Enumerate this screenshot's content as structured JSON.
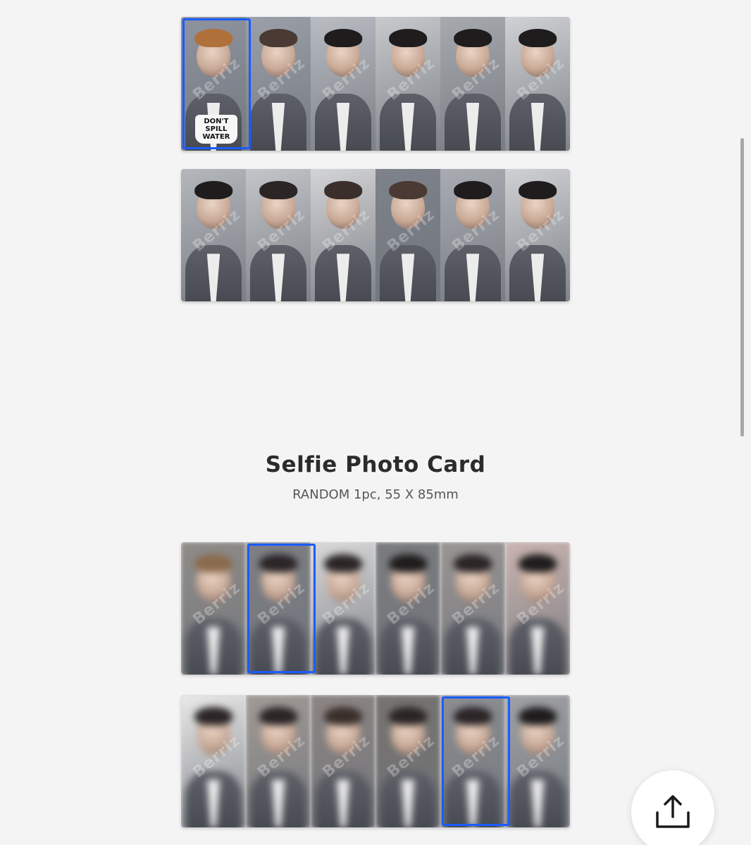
{
  "section": {
    "title": "Selfie Photo Card",
    "subtitle": "RANDOM 1pc, 55 X 85mm"
  },
  "watermark_text": "Berriz",
  "share_button": {
    "icon": "share-upload-icon"
  },
  "colors": {
    "background": "#f4f4f4",
    "highlight": "#1a5cff",
    "title_text": "#2b2b2b",
    "subtitle_text": "#555555"
  },
  "strips": [
    {
      "name": "photo-card-strip-1",
      "blurred": false,
      "highlight_index": 0,
      "cards": [
        {
          "bg": "#8e939e",
          "hair": "#b0703a",
          "mug_text": "DON'T SPILL WATER"
        },
        {
          "bg": "#9ba0a8",
          "hair": "#4a3a33"
        },
        {
          "bg": "#b9bcc2",
          "hair": "#1f1c1d"
        },
        {
          "bg": "#c7c9cc",
          "hair": "#1f1c1d"
        },
        {
          "bg": "#a6a9ae",
          "hair": "#1f1c1d"
        },
        {
          "bg": "#cfd1d4",
          "hair": "#1f1c1d"
        }
      ]
    },
    {
      "name": "photo-card-strip-2",
      "blurred": false,
      "highlight_index": -1,
      "cards": [
        {
          "bg": "#b4b7bc",
          "hair": "#1f1c1d"
        },
        {
          "bg": "#c3c5c9",
          "hair": "#2b2526"
        },
        {
          "bg": "#d3d4d6",
          "hair": "#3a2f2a"
        },
        {
          "bg": "#7e828a",
          "hair": "#4a3a33"
        },
        {
          "bg": "#a9acb2",
          "hair": "#1f1c1d"
        },
        {
          "bg": "#cfd1d4",
          "hair": "#1f1c1d"
        }
      ]
    },
    {
      "name": "selfie-card-strip-1",
      "blurred": true,
      "highlight_index": 1,
      "cards": [
        {
          "bg": "#8f8c89",
          "hair": "#8a6a4c"
        },
        {
          "bg": "#7d7f84",
          "hair": "#2b2526"
        },
        {
          "bg": "#d9d9d9",
          "hair": "#2b2526"
        },
        {
          "bg": "#7b7c7f",
          "hair": "#1f1c1d"
        },
        {
          "bg": "#9a9594",
          "hair": "#2b2526"
        },
        {
          "bg": "#c9b4b0",
          "hair": "#1f1c1d"
        }
      ]
    },
    {
      "name": "selfie-card-strip-2",
      "blurred": true,
      "highlight_index": 4,
      "cards": [
        {
          "bg": "#e9e9e9",
          "hair": "#2b2526"
        },
        {
          "bg": "#a09a95",
          "hair": "#2b2526"
        },
        {
          "bg": "#8c8583",
          "hair": "#3a2f2a"
        },
        {
          "bg": "#76736f",
          "hair": "#2b2526"
        },
        {
          "bg": "#8c8e92",
          "hair": "#2b2526"
        },
        {
          "bg": "#9fa1a4",
          "hair": "#1f1c1d"
        }
      ]
    }
  ]
}
